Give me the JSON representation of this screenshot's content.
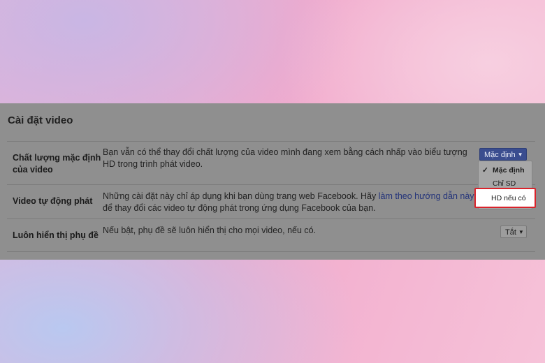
{
  "section_title": "Cài đặt video",
  "rows": [
    {
      "label_line1": "Chất lượng mặc định",
      "label_line2": "của video",
      "description": "Bạn vẫn có thể thay đổi chất lượng của video mình đang xem bằng cách nhấp vào biểu tượng HD trong trình phát video.",
      "control_value": "Mặc định"
    },
    {
      "label": "Video tự động phát",
      "description_before": "Những cài đặt này chỉ áp dụng khi bạn dùng trang web Facebook. Hãy ",
      "description_link": "làm theo hướng dẫn này",
      "description_after": " để thay đổi các video tự động phát trong ứng dụng Facebook của bạn."
    },
    {
      "label": "Luôn hiển thị phụ đề",
      "description": "Nếu bật, phụ đề sẽ luôn hiển thị cho mọi video, nếu có.",
      "control_value": "Tắt"
    }
  ],
  "dropdown": {
    "options": [
      "Mặc định",
      "Chỉ SD",
      "HD nếu có"
    ],
    "selected": "Mặc định",
    "check_glyph": "✓",
    "highlighted_option": "HD nếu có",
    "highlight_color": "#d9232b"
  },
  "caret_glyph": "▼",
  "colors": {
    "panel_bg": "#8f8f8f",
    "primary_button": "#3a4d8f",
    "link": "#24347a"
  }
}
